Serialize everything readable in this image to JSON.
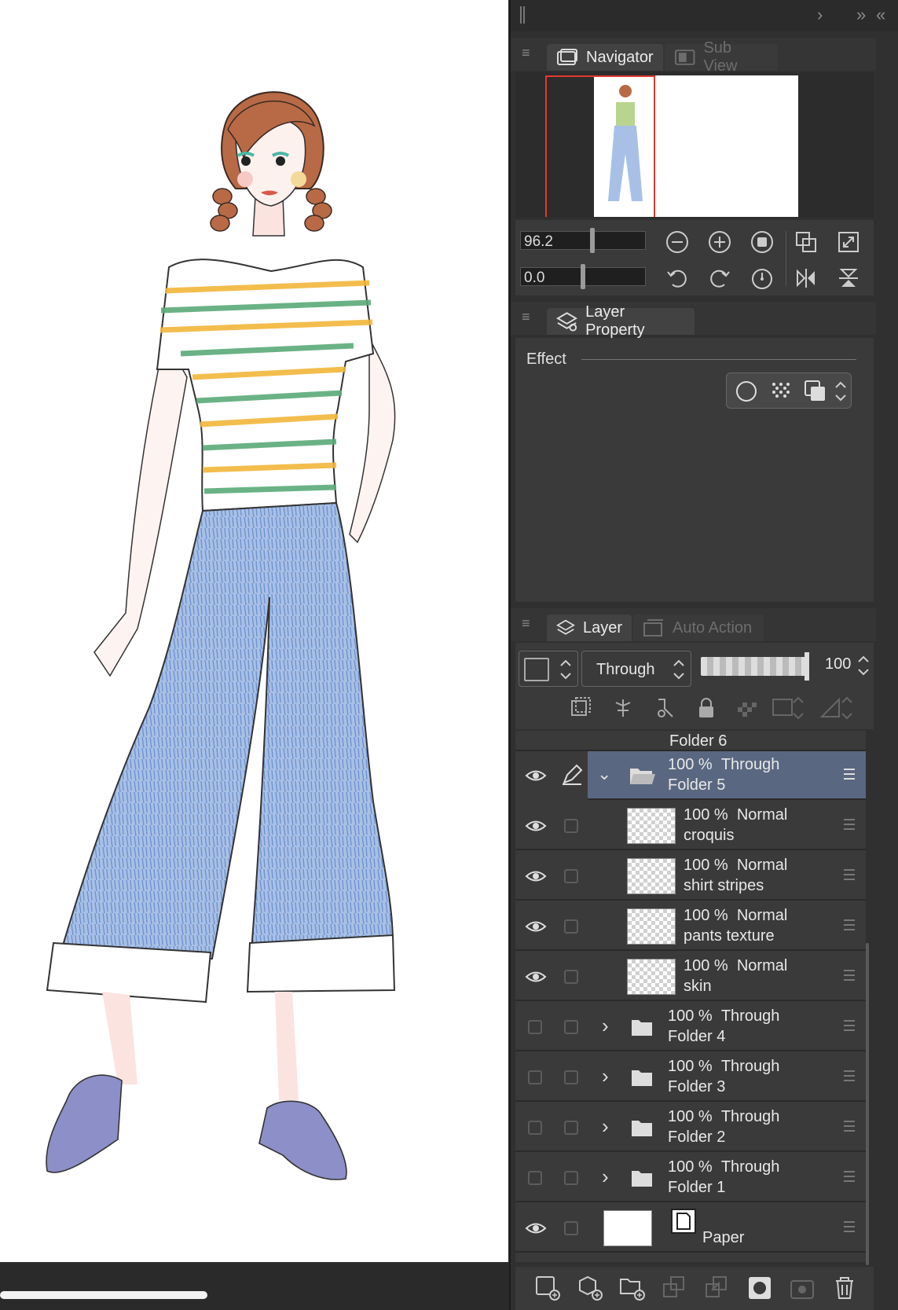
{
  "navigator": {
    "tab_navigator": "Navigator",
    "tab_subview": "Sub View",
    "zoom_value": "96.2",
    "rotation_value": "0.0"
  },
  "layer_property": {
    "tab_label": "Layer Property",
    "effect_label": "Effect"
  },
  "layer_panel": {
    "tab_layer": "Layer",
    "tab_auto_action": "Auto Action",
    "blend_mode": "Through",
    "opacity": "100",
    "partial_row": "Folder 6",
    "layers": [
      {
        "opacity": "100 %",
        "mode": "Through",
        "name": "Folder 5"
      },
      {
        "opacity": "100 %",
        "mode": "Normal",
        "name": "croquis"
      },
      {
        "opacity": "100 %",
        "mode": "Normal",
        "name": "shirt stripes"
      },
      {
        "opacity": "100 %",
        "mode": "Normal",
        "name": "pants texture"
      },
      {
        "opacity": "100 %",
        "mode": "Normal",
        "name": "skin"
      },
      {
        "opacity": "100 %",
        "mode": "Through",
        "name": "Folder 4"
      },
      {
        "opacity": "100 %",
        "mode": "Through",
        "name": "Folder 3"
      },
      {
        "opacity": "100 %",
        "mode": "Through",
        "name": "Folder 2"
      },
      {
        "opacity": "100 %",
        "mode": "Through",
        "name": "Folder 1"
      },
      {
        "opacity": "",
        "mode": "",
        "name": "Paper"
      }
    ]
  },
  "colors": {
    "selected_row": "#5a6780",
    "panel_bg": "#303030",
    "accent_red": "#e23a2e"
  }
}
